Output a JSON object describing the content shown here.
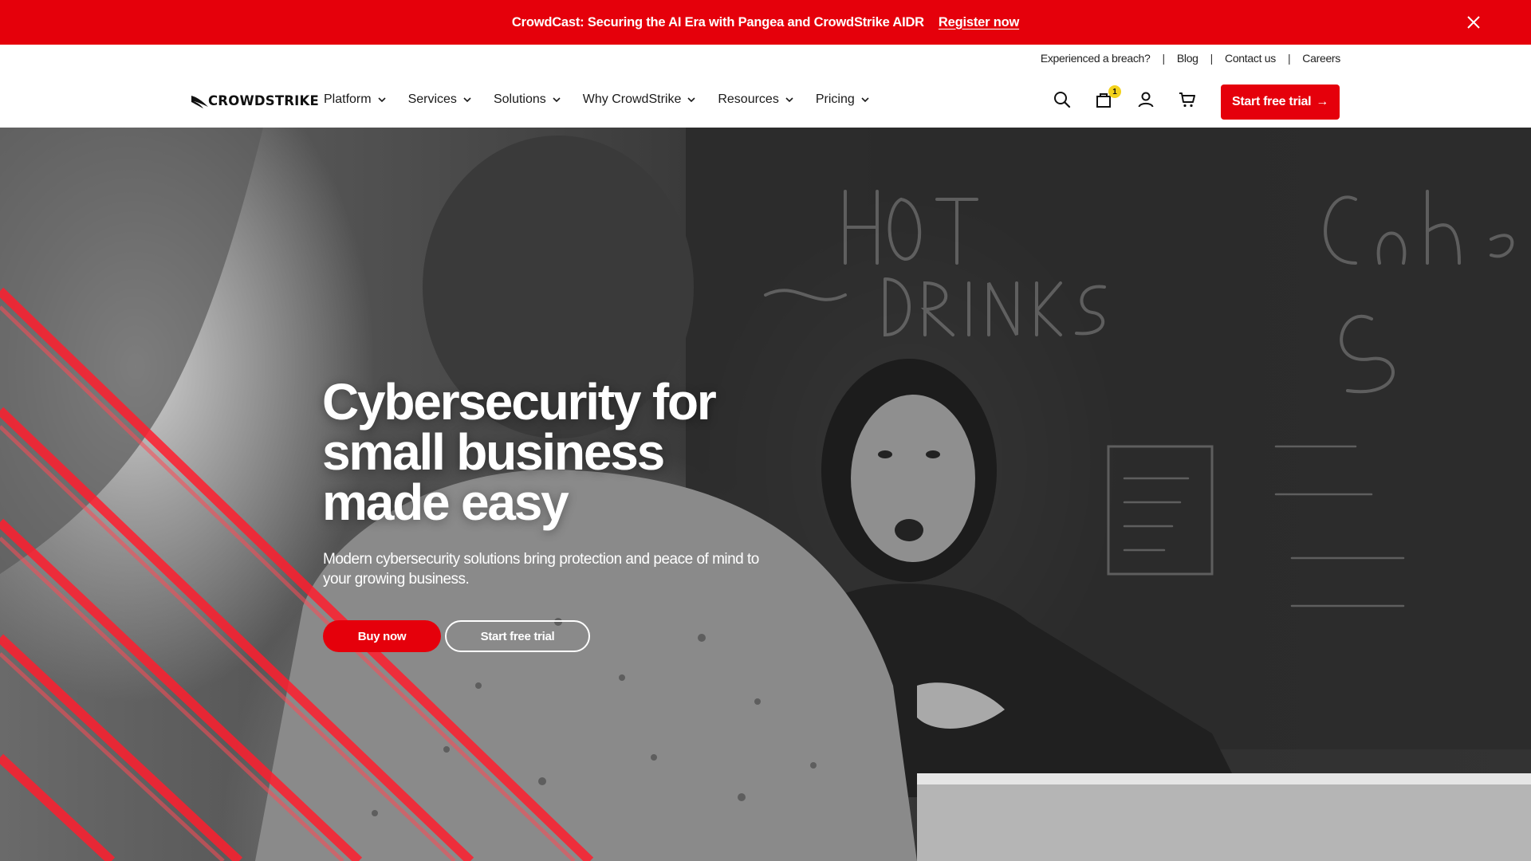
{
  "promo": {
    "text": "CrowdCast: Securing the AI Era with Pangea and CrowdStrike AIDR",
    "link": "Register now",
    "close_icon": "close-icon"
  },
  "utility": [
    "Experienced a breach?",
    "Blog",
    "Contact us",
    "Careers"
  ],
  "logo": {
    "text": "CROWDSTRIKE",
    "icon": "falcon-logo"
  },
  "menu": [
    "Platform",
    "Services",
    "Solutions",
    "Why CrowdStrike",
    "Resources",
    "Pricing"
  ],
  "icons": {
    "search": "search-icon",
    "bag": "shopping-bag-icon",
    "bag_badge": "1",
    "account": "user-icon",
    "cart": "cart-icon"
  },
  "cta": {
    "label": "Start free trial",
    "arrow": "→"
  },
  "hero": {
    "title": "Cybersecurity for small business made easy",
    "subtitle": "Modern cybersecurity solutions bring protection and peace of mind to your growing business.",
    "buy": "Buy now",
    "trial": "Start free trial"
  },
  "colors": {
    "brand_red": "#e5000b",
    "badge_yellow": "#f3d21b"
  }
}
